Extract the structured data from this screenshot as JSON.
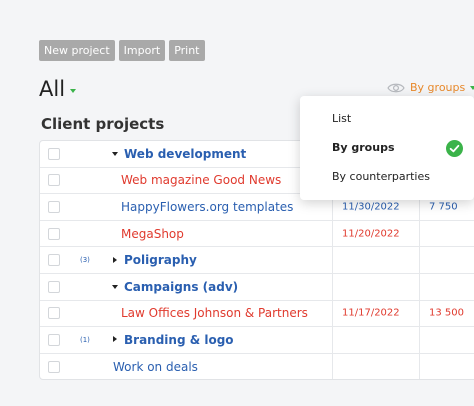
{
  "toolbar": {
    "new_project": "New project",
    "import": "Import",
    "print": "Print"
  },
  "filter": {
    "title": "All"
  },
  "view_selector": {
    "label": "By groups",
    "icon": "eye-icon"
  },
  "section": {
    "title": "Client projects"
  },
  "rows": [
    {
      "kind": "group",
      "expanded": true,
      "count": "",
      "name": "Web development",
      "date": "",
      "amount": ""
    },
    {
      "kind": "item",
      "style": "red",
      "name": "Web magazine Good News",
      "date": "",
      "amount": ""
    },
    {
      "kind": "item",
      "style": "blue",
      "name": "HappyFlowers.org templates",
      "date": "11/30/2022",
      "amount": "7 750"
    },
    {
      "kind": "item",
      "style": "red",
      "name": "MegaShop",
      "date": "11/20/2022",
      "amount": ""
    },
    {
      "kind": "group",
      "expanded": false,
      "count": "(3)",
      "name": "Poligraphy",
      "date": "",
      "amount": ""
    },
    {
      "kind": "group",
      "expanded": true,
      "count": "",
      "name": "Campaigns (adv)",
      "date": "",
      "amount": ""
    },
    {
      "kind": "item",
      "style": "red",
      "name": "Law Offices Johnson & Partners",
      "date": "11/17/2022",
      "amount": "13 500"
    },
    {
      "kind": "group",
      "expanded": false,
      "count": "(1)",
      "name": "Branding & logo",
      "date": "",
      "amount": ""
    },
    {
      "kind": "plain",
      "style": "blue",
      "name": "Work on deals",
      "date": "",
      "amount": ""
    }
  ],
  "menu": {
    "items": [
      {
        "label": "List",
        "selected": false
      },
      {
        "label": "By groups",
        "selected": true
      },
      {
        "label": "By counterparties",
        "selected": false
      }
    ],
    "check_icon": "check-circle-icon"
  },
  "colors": {
    "accent_green": "#3bb34a",
    "view_orange": "#e8892b",
    "link_blue": "#2a5fb0",
    "overdue_red": "#e03a2e",
    "button_gray": "#a9a9a9"
  }
}
